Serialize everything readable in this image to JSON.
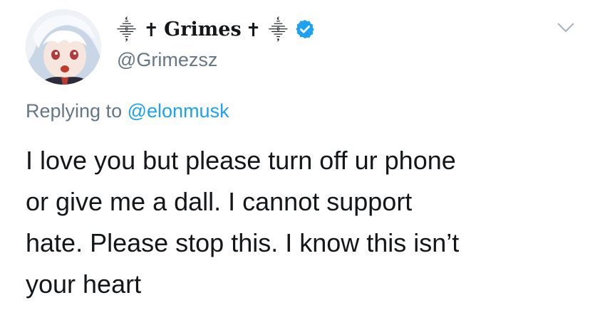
{
  "author": {
    "display_name": "Grimes",
    "deco_left": "⸎ ✝",
    "deco_right": "✝ ⸎",
    "handle": "@Grimezsz",
    "verified": true
  },
  "reply": {
    "prefix": "Replying to",
    "mention": "@elonmusk"
  },
  "tweet": {
    "lines": [
      "I love you but please turn off ur phone",
      "or give me a dall.  I cannot support",
      "hate.  Please stop this. I know this isn’t",
      "your heart"
    ]
  },
  "colors": {
    "text": "#14171a",
    "secondary": "#657786",
    "link": "#1da1f2",
    "verified": "#1da1f2"
  },
  "icons": {
    "verified": "verified-badge-icon",
    "more": "chevron-down-icon"
  }
}
